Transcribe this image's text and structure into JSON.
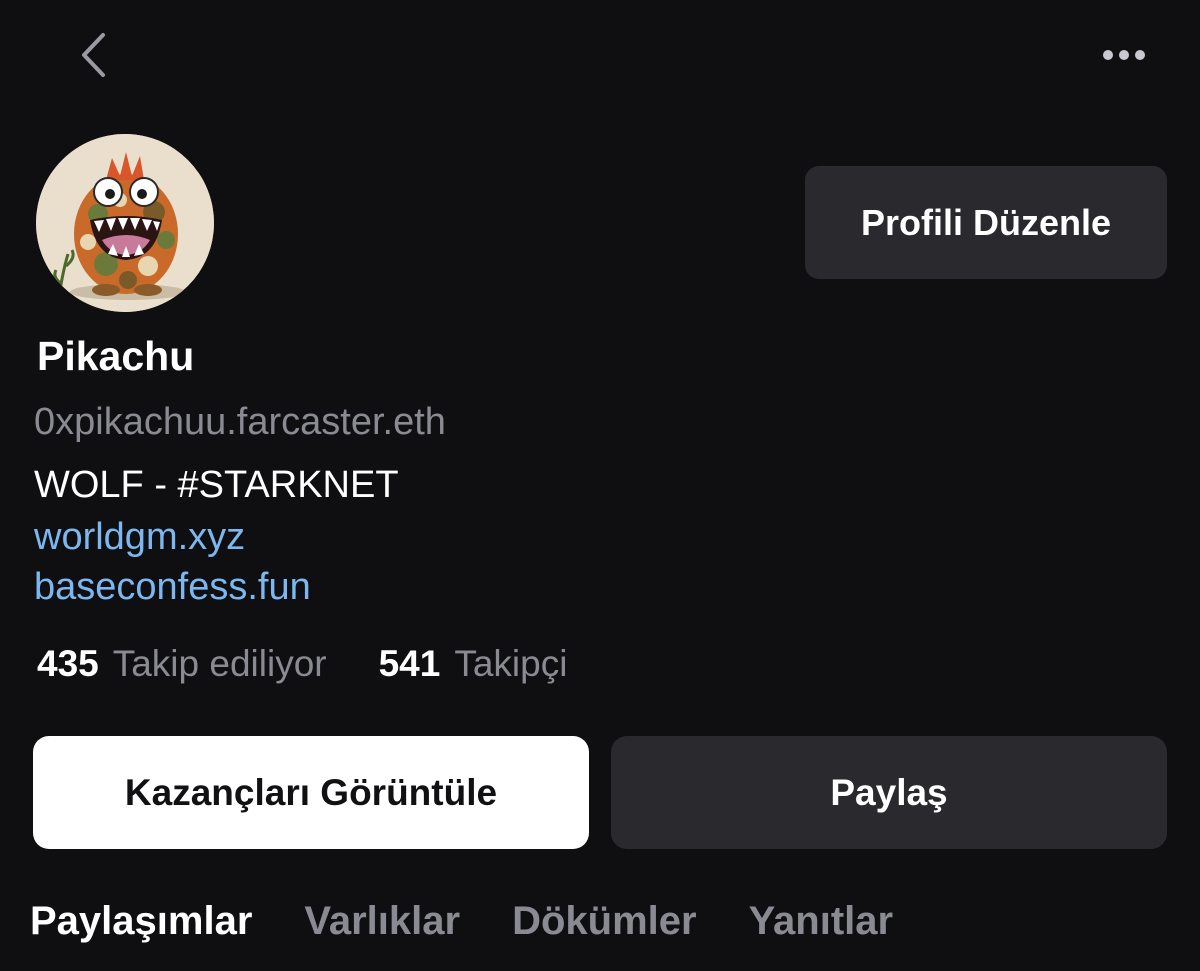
{
  "header": {
    "back_icon": "chevron-left-icon",
    "more_icon": "more-horizontal-icon"
  },
  "profile": {
    "display_name": "Pikachu",
    "username": "0xpikachuu.farcaster.eth",
    "bio": "WOLF - #STARKNET",
    "links": [
      "worldgm.xyz",
      "baseconfess.fun"
    ],
    "edit_label": "Profili Düzenle"
  },
  "stats": {
    "following_count": "435",
    "following_label": "Takip ediliyor",
    "followers_count": "541",
    "followers_label": "Takipçi"
  },
  "actions": {
    "earnings_label": "Kazançları Görüntüle",
    "share_label": "Paylaş"
  },
  "tabs": [
    {
      "label": "Paylaşımlar",
      "active": true
    },
    {
      "label": "Varlıklar",
      "active": false
    },
    {
      "label": "Dökümler",
      "active": false
    },
    {
      "label": "Yanıtlar",
      "active": false
    }
  ],
  "colors": {
    "background": "#0f0f12",
    "surface": "#2a2a2e",
    "muted_text": "#8a8a93",
    "link": "#7cb8ef"
  }
}
